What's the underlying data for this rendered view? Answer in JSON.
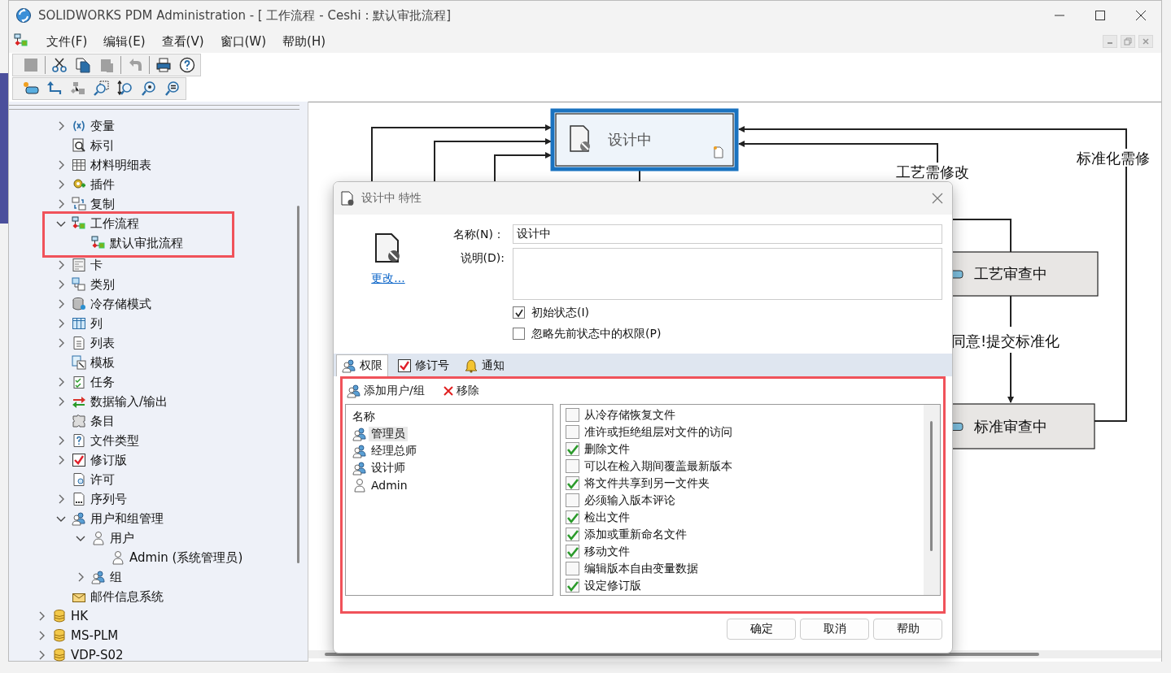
{
  "window": {
    "title": "SOLIDWORKS PDM Administration - [ 工作流程 - Ceshi : 默认审批流程]"
  },
  "menu": [
    {
      "label": "文件(F)"
    },
    {
      "label": "编辑(E)"
    },
    {
      "label": "查看(V)"
    },
    {
      "label": "窗口(W)"
    },
    {
      "label": "帮助(H)"
    }
  ],
  "toolbar_rows": [
    [
      {
        "disabled": true
      },
      {
        "disabled": false
      },
      {
        "disabled": false
      },
      {
        "disabled": true
      },
      {
        "disabled": true
      },
      {
        "disabled": false
      },
      {
        "disabled": false
      }
    ],
    [
      {
        "disabled": false
      },
      {
        "disabled": false
      },
      {
        "disabled": true
      },
      {
        "disabled": false
      },
      {
        "disabled": false
      },
      {
        "disabled": false
      },
      {
        "disabled": false
      }
    ]
  ],
  "tree": {
    "vault_items": [
      {
        "label": "变量",
        "expanded": false
      },
      {
        "label": "标引"
      },
      {
        "label": "材料明细表",
        "expanded": false
      },
      {
        "label": "插件",
        "expanded": false
      },
      {
        "label": "复制",
        "expanded": false
      },
      {
        "label": "工作流程",
        "expanded": true,
        "highlighted": true,
        "children": [
          {
            "label": "默认审批流程"
          }
        ]
      },
      {
        "label": "卡",
        "expanded": false
      },
      {
        "label": "类别",
        "expanded": false
      },
      {
        "label": "冷存储模式",
        "expanded": false
      },
      {
        "label": "列",
        "expanded": false
      },
      {
        "label": "列表",
        "expanded": false
      },
      {
        "label": "模板"
      },
      {
        "label": "任务",
        "expanded": false
      },
      {
        "label": "数据输入/输出",
        "expanded": false
      },
      {
        "label": "条目"
      },
      {
        "label": "文件类型",
        "expanded": false
      },
      {
        "label": "修订版",
        "expanded": false
      },
      {
        "label": "许可"
      },
      {
        "label": "序列号",
        "expanded": false
      },
      {
        "label": "用户和组管理",
        "expanded": true,
        "children": [
          {
            "label": "用户",
            "expanded": true,
            "children": [
              {
                "label": "Admin (系统管理员)"
              }
            ]
          },
          {
            "label": "组",
            "expanded": false
          }
        ]
      },
      {
        "label": "邮件信息系统"
      }
    ],
    "vaults": [
      {
        "label": "HK",
        "expanded": false
      },
      {
        "label": "MS-PLM",
        "expanded": false
      },
      {
        "label": "VDP-S02",
        "expanded": false
      }
    ]
  },
  "workflow": {
    "states": [
      {
        "label": "设计中",
        "selected": true
      },
      {
        "label": "工艺审查中",
        "selected": false
      },
      {
        "label": "标准审查中",
        "selected": false
      }
    ],
    "transitions": [
      {
        "label": "工艺需修改"
      },
      {
        "label": "标准化需修"
      },
      {
        "label": "同意!提交标准化"
      }
    ]
  },
  "dialog": {
    "title": "设计中 特性",
    "change_link": "更改...",
    "name_label": "名称(N)：",
    "name_value": "设计中",
    "description_label": "说明(D):",
    "options": [
      {
        "label": "初始状态(I)",
        "checked": true
      },
      {
        "label": "忽略先前状态中的权限(P)",
        "checked": false
      }
    ],
    "tabs": [
      {
        "label": "权限",
        "selected": true
      },
      {
        "label": "修订号",
        "selected": false
      },
      {
        "label": "通知",
        "selected": false
      }
    ],
    "highlighted": true,
    "add_button": "添加用户/组",
    "remove_button": "移除",
    "users_header": "名称",
    "users": [
      {
        "label": "管理员",
        "kind": "group",
        "selected": true
      },
      {
        "label": "经理总师",
        "kind": "group",
        "selected": false
      },
      {
        "label": "设计师",
        "kind": "group",
        "selected": false
      },
      {
        "label": "Admin",
        "kind": "user",
        "selected": false
      }
    ],
    "permissions": [
      {
        "label": "从冷存储恢复文件",
        "checked": false
      },
      {
        "label": "准许或拒绝组层对文件的访问",
        "checked": false
      },
      {
        "label": "删除文件",
        "checked": true
      },
      {
        "label": "可以在检入期间覆盖最新版本",
        "checked": false
      },
      {
        "label": "将文件共享到另一文件夹",
        "checked": true
      },
      {
        "label": "必须输入版本评论",
        "checked": false
      },
      {
        "label": "检出文件",
        "checked": true
      },
      {
        "label": "添加或重新命名文件",
        "checked": true
      },
      {
        "label": "移动文件",
        "checked": true
      },
      {
        "label": "编辑版本自由变量数据",
        "checked": false
      },
      {
        "label": "设定修订版",
        "checked": true
      }
    ],
    "buttons": [
      {
        "label": "确定"
      },
      {
        "label": "取消"
      },
      {
        "label": "帮助"
      }
    ]
  }
}
